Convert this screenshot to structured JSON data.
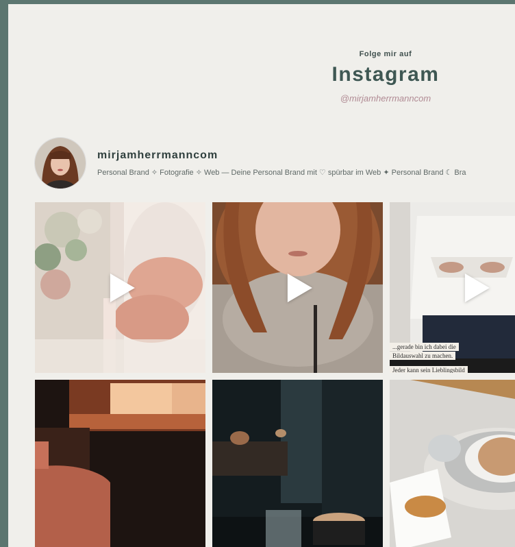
{
  "header": {
    "eyebrow": "Folge mir auf",
    "title": "Instagram",
    "handle": "@mirjamherrmanncom"
  },
  "profile": {
    "username": "mirjamherrmanncom",
    "bio": "Personal Brand ✧ Fotografie ✧ Web — Deine Personal Brand mit ♡ spürbar im Web ✦ Personal Brand ☾ Bra"
  },
  "posts": [
    {
      "type": "video"
    },
    {
      "type": "video"
    },
    {
      "type": "video",
      "caption_line1": "...gerade bin ich dabei die",
      "caption_line2": "Bildauswahl zu machen.",
      "caption_line3": "Jeder kann sein Lieblingsbild"
    },
    {
      "type": "image"
    },
    {
      "type": "image"
    },
    {
      "type": "image"
    }
  ],
  "colors": {
    "frame": "#5c7670",
    "panel": "#f0efeb",
    "title": "#3e5753",
    "handle": "#b08a93"
  },
  "icons": {
    "play": "play-icon"
  }
}
